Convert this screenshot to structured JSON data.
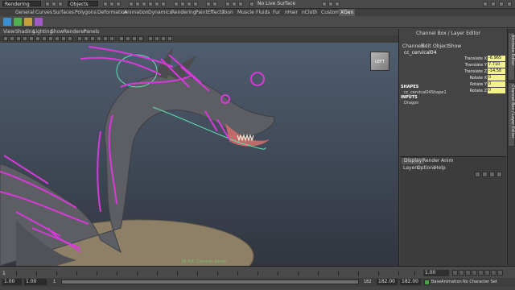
{
  "toolbar": {
    "mode": "Rendering",
    "object_mode": "Objects",
    "live_surface": "No Live Surface"
  },
  "shelf_tabs": [
    "General",
    "Curves",
    "Surfaces",
    "Polygons",
    "Deformation",
    "Animation",
    "Dynamics",
    "Rendering",
    "PaintEffects",
    "Toon",
    "Muscle",
    "Fluids",
    "Fur",
    "nHair",
    "nCloth",
    "Custom",
    "XGen"
  ],
  "active_shelf": "XGen",
  "viewport": {
    "menus": [
      "View",
      "Shading",
      "Lighting",
      "Show",
      "Renderer",
      "Panels"
    ],
    "viewcube_label": "LEFT",
    "camera_label": "29 Pyf, Camera: persp"
  },
  "channel_box": {
    "title": "Channel Box / Layer Editor",
    "menus": [
      "Channels",
      "Edit",
      "Object",
      "Show"
    ],
    "object_name": "cc_cervical04",
    "attributes": [
      {
        "label": "Translate X",
        "value": "-6.965"
      },
      {
        "label": "Translate Y",
        "value": "7.710"
      },
      {
        "label": "Translate Z",
        "value": "-14.58"
      },
      {
        "label": "Rotate X",
        "value": "0"
      },
      {
        "label": "Rotate Y",
        "value": "0"
      },
      {
        "label": "Rotate Z",
        "value": "0"
      }
    ],
    "shapes_header": "SHAPES",
    "shape_name": "cc_cervical04Shape1",
    "inputs_header": "INPUTS",
    "input_name": "Dragon"
  },
  "side_tabs": [
    "Attribute Editor",
    "Channel Box / Layer Editor"
  ],
  "layer_editor": {
    "tabs": [
      "Display",
      "Render",
      "Anim"
    ],
    "active_tab": "Display",
    "menus": [
      "Layers",
      "Options",
      "Help"
    ]
  },
  "timeline": {
    "start": "1",
    "current": "1.00"
  },
  "range": {
    "start": "1.00",
    "inner_start": "1.00",
    "marker": "1",
    "inner_end": "182",
    "end": "182.00",
    "end2": "182.00",
    "anim_layer": "BaseAnimation",
    "character_set": "No Character Set"
  },
  "colors": {
    "rig_curve": "#d63ad8",
    "selection": "#5fe0b0",
    "channel_highlight": "#f2f28a"
  }
}
